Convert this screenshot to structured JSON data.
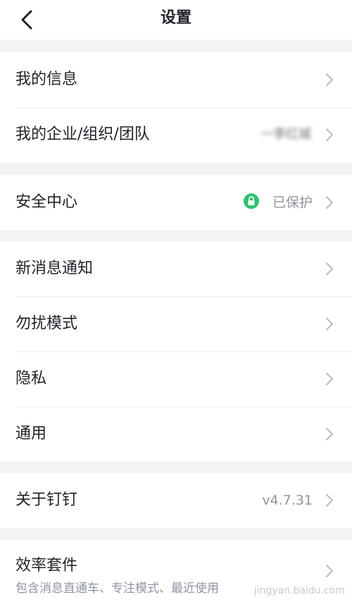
{
  "header": {
    "title": "设置"
  },
  "groups": {
    "g1": [
      {
        "label": "我的信息"
      },
      {
        "label": "我的企业/组织/团队",
        "value": "一李红城"
      }
    ],
    "g2": [
      {
        "label": "安全中心",
        "value": "已保护"
      }
    ],
    "g3": [
      {
        "label": "新消息通知"
      },
      {
        "label": "勿扰模式"
      },
      {
        "label": "隐私"
      },
      {
        "label": "通用"
      }
    ],
    "g4": [
      {
        "label": "关于钉钉",
        "value": "v4.7.31"
      }
    ],
    "g5": [
      {
        "label": "效率套件",
        "subtitle": "包含消息直通车、专注模式、最近使用"
      }
    ]
  },
  "watermark": "jingyan.baidu.com",
  "colors": {
    "lock": "#2bc26b",
    "background": "#f2f3f5"
  },
  "icons": {
    "back": "chevron-left-icon",
    "row": "chevron-right-icon",
    "lock": "lock-icon"
  }
}
